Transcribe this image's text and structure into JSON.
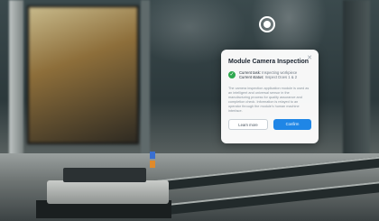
{
  "dialog": {
    "title": "Module Camera Inspection",
    "status": {
      "task_label": "Current task:",
      "task_value": "Inspecting workpiece",
      "status_label": "Current status:",
      "status_value": "Inspect Does 1 & 2"
    },
    "description": "The camera inspection application module is used as an intelligent and universal sensor in the manufacturing process for quality assurance and completion check. Information is relayed to an operator through the module's human machine interface.",
    "buttons": {
      "secondary": "Learn more",
      "primary": "Confirm"
    }
  },
  "icons": {
    "close": "close-icon",
    "status": "check-circle-icon",
    "target": "target-ring-icon"
  },
  "colors": {
    "primary": "#1f86e6",
    "success": "#2fa84f"
  }
}
